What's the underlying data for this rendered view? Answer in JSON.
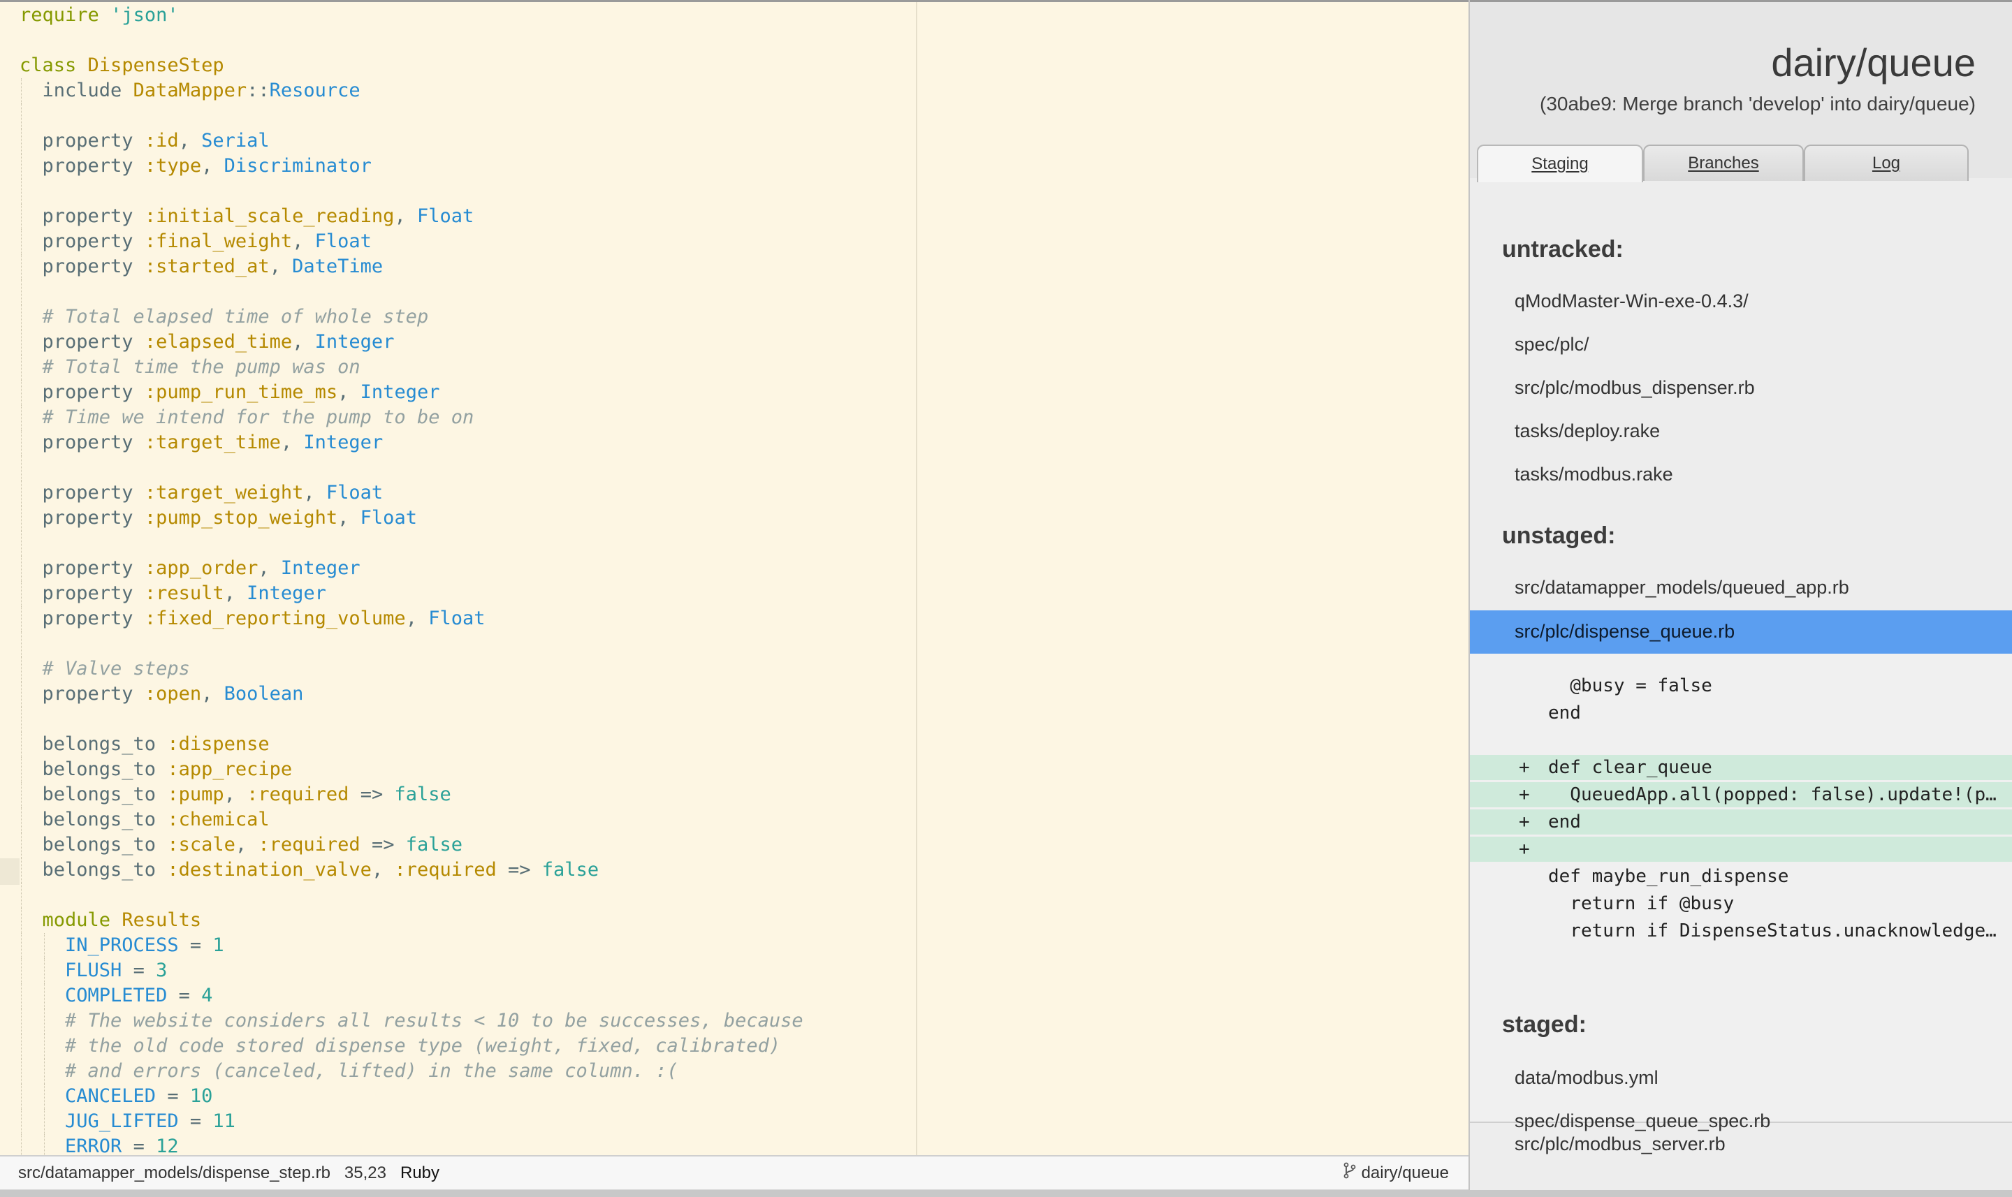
{
  "editor": {
    "lines": [
      [
        [
          "kw",
          "require"
        ],
        [
          "plain",
          " "
        ],
        [
          "str",
          "'json'"
        ]
      ],
      [],
      [
        [
          "kw",
          "class"
        ],
        [
          "plain",
          " "
        ],
        [
          "class",
          "DispenseStep"
        ]
      ],
      [
        [
          "plain",
          "  include "
        ],
        [
          "class",
          "DataMapper"
        ],
        [
          "op",
          "::"
        ],
        [
          "const",
          "Resource"
        ]
      ],
      [],
      [
        [
          "plain",
          "  property "
        ],
        [
          "sym",
          ":id"
        ],
        [
          "plain",
          ", "
        ],
        [
          "const",
          "Serial"
        ]
      ],
      [
        [
          "plain",
          "  property "
        ],
        [
          "sym",
          ":type"
        ],
        [
          "plain",
          ", "
        ],
        [
          "const",
          "Discriminator"
        ]
      ],
      [],
      [
        [
          "plain",
          "  property "
        ],
        [
          "sym",
          ":initial_scale_reading"
        ],
        [
          "plain",
          ", "
        ],
        [
          "const",
          "Float"
        ]
      ],
      [
        [
          "plain",
          "  property "
        ],
        [
          "sym",
          ":final_weight"
        ],
        [
          "plain",
          ", "
        ],
        [
          "const",
          "Float"
        ]
      ],
      [
        [
          "plain",
          "  property "
        ],
        [
          "sym",
          ":started_at"
        ],
        [
          "plain",
          ", "
        ],
        [
          "const",
          "DateTime"
        ]
      ],
      [],
      [
        [
          "com",
          "  # Total elapsed time of whole step"
        ]
      ],
      [
        [
          "plain",
          "  property "
        ],
        [
          "sym",
          ":elapsed_time"
        ],
        [
          "plain",
          ", "
        ],
        [
          "const",
          "Integer"
        ]
      ],
      [
        [
          "com",
          "  # Total time the pump was on"
        ]
      ],
      [
        [
          "plain",
          "  property "
        ],
        [
          "sym",
          ":pump_run_time_ms"
        ],
        [
          "plain",
          ", "
        ],
        [
          "const",
          "Integer"
        ]
      ],
      [
        [
          "com",
          "  # Time we intend for the pump to be on"
        ]
      ],
      [
        [
          "plain",
          "  property "
        ],
        [
          "sym",
          ":target_time"
        ],
        [
          "plain",
          ", "
        ],
        [
          "const",
          "Integer"
        ]
      ],
      [],
      [
        [
          "plain",
          "  property "
        ],
        [
          "sym",
          ":target_weight"
        ],
        [
          "plain",
          ", "
        ],
        [
          "const",
          "Float"
        ]
      ],
      [
        [
          "plain",
          "  property "
        ],
        [
          "sym",
          ":pump_stop_weight"
        ],
        [
          "plain",
          ", "
        ],
        [
          "const",
          "Float"
        ]
      ],
      [],
      [
        [
          "plain",
          "  property "
        ],
        [
          "sym",
          ":app_order"
        ],
        [
          "plain",
          ", "
        ],
        [
          "const",
          "Integer"
        ]
      ],
      [
        [
          "plain",
          "  property "
        ],
        [
          "sym",
          ":result"
        ],
        [
          "plain",
          ", "
        ],
        [
          "const",
          "Integer"
        ]
      ],
      [
        [
          "plain",
          "  property "
        ],
        [
          "sym",
          ":fixed_reporting_volume"
        ],
        [
          "plain",
          ", "
        ],
        [
          "const",
          "Float"
        ]
      ],
      [],
      [
        [
          "com",
          "  # Valve steps"
        ]
      ],
      [
        [
          "plain",
          "  property "
        ],
        [
          "sym",
          ":open"
        ],
        [
          "plain",
          ", "
        ],
        [
          "const",
          "Boolean"
        ]
      ],
      [],
      [
        [
          "plain",
          "  belongs_to "
        ],
        [
          "sym",
          ":dispense"
        ]
      ],
      [
        [
          "plain",
          "  belongs_to "
        ],
        [
          "sym",
          ":app_recipe"
        ]
      ],
      [
        [
          "plain",
          "  belongs_to "
        ],
        [
          "sym",
          ":pump"
        ],
        [
          "plain",
          ", "
        ],
        [
          "sym",
          ":required"
        ],
        [
          "plain",
          " => "
        ],
        [
          "lit",
          "false"
        ]
      ],
      [
        [
          "plain",
          "  belongs_to "
        ],
        [
          "sym",
          ":chemical"
        ]
      ],
      [
        [
          "plain",
          "  belongs_to "
        ],
        [
          "sym",
          ":scale"
        ],
        [
          "plain",
          ", "
        ],
        [
          "sym",
          ":required"
        ],
        [
          "plain",
          " => "
        ],
        [
          "lit",
          "false"
        ]
      ],
      [
        [
          "plain",
          "  belongs_to "
        ],
        [
          "sym",
          ":destination_valve"
        ],
        [
          "plain",
          ", "
        ],
        [
          "sym",
          ":required"
        ],
        [
          "plain",
          " => "
        ],
        [
          "lit",
          "false"
        ]
      ],
      [],
      [
        [
          "kw",
          "  module"
        ],
        [
          "plain",
          " "
        ],
        [
          "class",
          "Results"
        ]
      ],
      [
        [
          "const",
          "    IN_PROCESS"
        ],
        [
          "plain",
          " = "
        ],
        [
          "lit",
          "1"
        ]
      ],
      [
        [
          "const",
          "    FLUSH"
        ],
        [
          "plain",
          " = "
        ],
        [
          "lit",
          "3"
        ]
      ],
      [
        [
          "const",
          "    COMPLETED"
        ],
        [
          "plain",
          " = "
        ],
        [
          "lit",
          "4"
        ]
      ],
      [
        [
          "com",
          "    # The website considers all results < 10 to be successes, because"
        ]
      ],
      [
        [
          "com",
          "    # the old code stored dispense type (weight, fixed, calibrated)"
        ]
      ],
      [
        [
          "com",
          "    # and errors (canceled, lifted) in the same column. :("
        ]
      ],
      [
        [
          "const",
          "    CANCELED"
        ],
        [
          "plain",
          " = "
        ],
        [
          "lit",
          "10"
        ]
      ],
      [
        [
          "const",
          "    JUG_LIFTED"
        ],
        [
          "plain",
          " = "
        ],
        [
          "lit",
          "11"
        ]
      ],
      [
        [
          "const",
          "    ERROR"
        ],
        [
          "plain",
          " = "
        ],
        [
          "lit",
          "12"
        ]
      ]
    ]
  },
  "statusbar": {
    "path": "src/datamapper_models/dispense_step.rb",
    "position": "35,23",
    "language": "Ruby",
    "branch": "dairy/queue",
    "branch_icon": "git-branch-icon"
  },
  "panel": {
    "title": "dairy/queue",
    "commit": "(30abe9: Merge branch 'develop' into dairy/queue)",
    "tabs": [
      {
        "label": "Staging",
        "active": true
      },
      {
        "label": "Branches",
        "active": false
      },
      {
        "label": "Log",
        "active": false
      }
    ],
    "untracked": {
      "heading": "untracked:",
      "files": [
        "qModMaster-Win-exe-0.4.3/",
        "spec/plc/",
        "src/plc/modbus_dispenser.rb",
        "tasks/deploy.rake",
        "tasks/modbus.rake"
      ]
    },
    "unstaged": {
      "heading": "unstaged:",
      "files": [
        "src/datamapper_models/queued_app.rb",
        "src/plc/dispense_queue.rb",
        "src/plc/modbus_server.rb"
      ],
      "selected": "src/plc/dispense_queue.rb"
    },
    "diff": [
      {
        "sign": " ",
        "text": "  @busy = false",
        "added": false
      },
      {
        "sign": " ",
        "text": "end",
        "added": false
      },
      {
        "sign": " ",
        "text": "",
        "added": false
      },
      {
        "sign": "+",
        "text": "def clear_queue",
        "added": true
      },
      {
        "sign": "+",
        "text": "  QueuedApp.all(popped: false).update!(p…",
        "added": true
      },
      {
        "sign": "+",
        "text": "end",
        "added": true
      },
      {
        "sign": "+",
        "text": "",
        "added": true
      },
      {
        "sign": " ",
        "text": "def maybe_run_dispense",
        "added": false
      },
      {
        "sign": " ",
        "text": "  return if @busy",
        "added": false
      },
      {
        "sign": " ",
        "text": "  return if DispenseStatus.unacknowledge…",
        "added": false
      }
    ],
    "staged": {
      "heading": "staged:",
      "files": [
        "data/modbus.yml",
        "spec/dispense_queue_spec.rb"
      ]
    }
  }
}
